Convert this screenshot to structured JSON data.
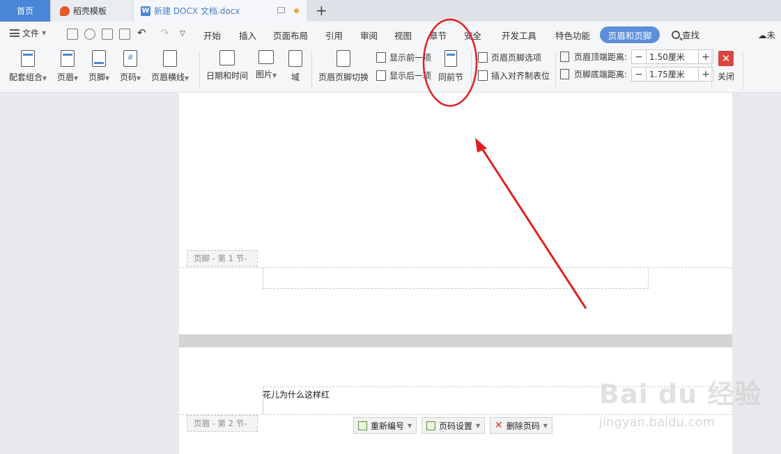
{
  "tabs": {
    "home": "首页",
    "template": "稻壳模板",
    "document": "新建 DOCX 文档.docx",
    "new_tab": "+"
  },
  "menu": {
    "file": "文件",
    "items": [
      "开始",
      "插入",
      "页面布局",
      "引用",
      "审阅",
      "视图",
      "章节",
      "安全",
      "开发工具",
      "特色功能"
    ],
    "active": "页眉和页脚",
    "search": "查找",
    "sync": "未"
  },
  "ribbon": {
    "combo": "配套组合",
    "header": "页眉",
    "footer": "页脚",
    "page_number": "页码",
    "header_line": "页眉横线",
    "datetime": "日期和时间",
    "picture": "图片",
    "field": "域",
    "switch": "页眉页脚切换",
    "show_prev": "显示前一项",
    "show_next": "显示后一项",
    "same_as_prev": "同前节",
    "options": "页眉页脚选项",
    "align_tab": "插入对齐制表位",
    "header_top_label": "页眉顶端距离:",
    "header_top_value": "1.50厘米",
    "footer_bottom_label": "页脚底端距离:",
    "footer_bottom_value": "1.75厘米",
    "close": "关闭"
  },
  "document": {
    "footer_tag_1": "页脚 - 第 1 节-",
    "header_tag_2": "页眉 - 第 2 节-",
    "body_text": "花儿为什么这样红",
    "renumber": "重新编号",
    "page_num_settings": "页码设置",
    "delete_page_num": "删除页码"
  },
  "watermark": {
    "brand": "Bai du 经验",
    "url": "jingyan.baidu.com"
  },
  "colors": {
    "accent": "#4a86d8",
    "annotation": "#e02020",
    "close": "#d9463e"
  }
}
